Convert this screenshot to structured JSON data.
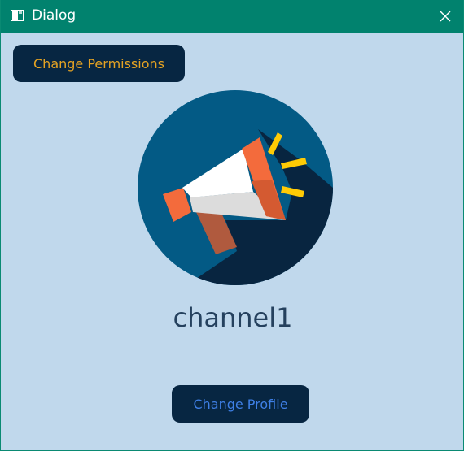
{
  "window": {
    "title": "Dialog"
  },
  "actions": {
    "change_permissions_label": "Change Permissions",
    "change_profile_label": "Change Profile"
  },
  "channel": {
    "name": "channel1",
    "avatar_icon": "megaphone-icon"
  },
  "colors": {
    "titlebar": "#01826e",
    "background": "#c0d8ec",
    "button_bg": "#072642",
    "permissions_text": "#e5a323",
    "profile_text": "#3e7fe5",
    "name_text": "#25415e"
  }
}
